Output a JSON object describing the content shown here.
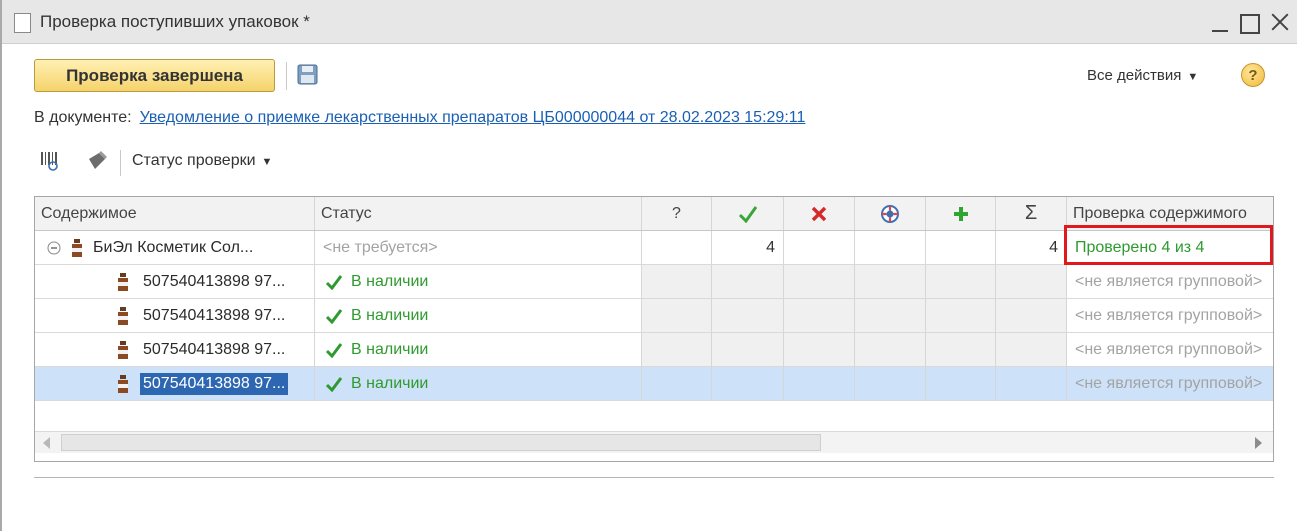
{
  "window": {
    "title": "Проверка поступивших упаковок *"
  },
  "toolbar": {
    "finish_label": "Проверка завершена",
    "all_actions_label": "Все действия",
    "help_label": "?"
  },
  "document": {
    "prefix": "В документе:",
    "link_text": "Уведомление о приемке лекарственных препаратов ЦБ000000044 от 28.02.2023 15:29:11"
  },
  "table_toolbar": {
    "status_menu_label": "Статус проверки"
  },
  "table": {
    "headers": {
      "content": "Содержимое",
      "status": "Статус",
      "unknown": "?",
      "sum": "Σ",
      "check": "Проверка содержимого"
    },
    "group_row": {
      "content": "БиЭл Косметик Сол...",
      "status": "<не требуется>",
      "ok_count": "4",
      "sum": "4",
      "check": "Проверено 4 из 4"
    },
    "rows": [
      {
        "content": "507540413898 97...",
        "status": "В наличии",
        "check": "<не является групповой>"
      },
      {
        "content": "507540413898 97...",
        "status": "В наличии",
        "check": "<не является групповой>"
      },
      {
        "content": "507540413898 97...",
        "status": "В наличии",
        "check": "<не является групповой>"
      },
      {
        "content": "507540413898 97...",
        "status": "В наличии",
        "check": "<не является групповой>"
      }
    ]
  },
  "colors": {
    "accent_button": "#f5d36c",
    "link": "#1a5fb4",
    "ok_green": "#2f9a2f",
    "error_red": "#e0191e",
    "selection": "#cde2f8"
  }
}
